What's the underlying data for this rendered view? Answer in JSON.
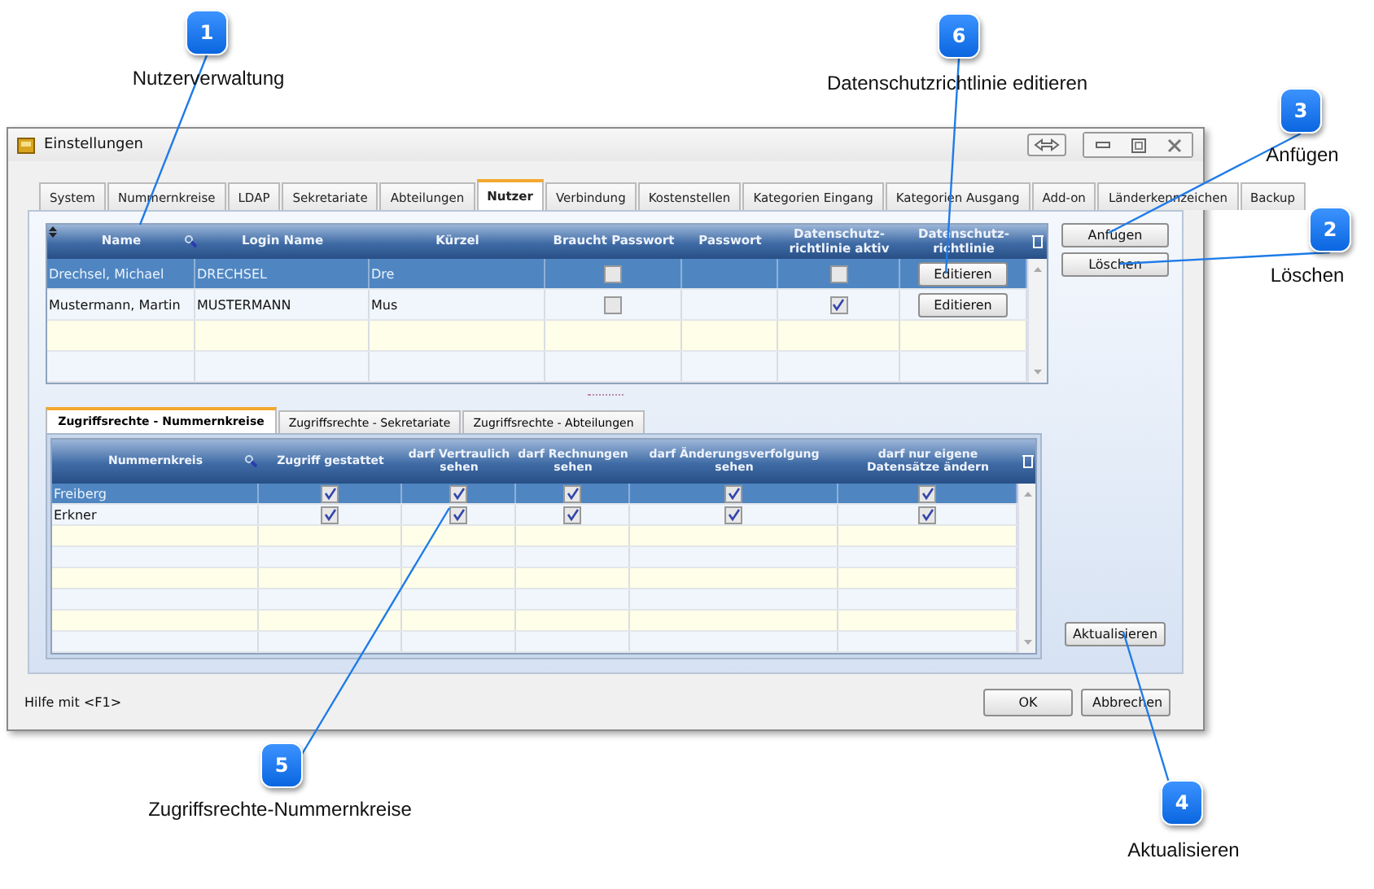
{
  "window": {
    "title": "Einstellungen"
  },
  "tabs": [
    {
      "label": "System",
      "selected": false
    },
    {
      "label": "Nummernkreise",
      "selected": false
    },
    {
      "label": "LDAP",
      "selected": false
    },
    {
      "label": "Sekretariate",
      "selected": false
    },
    {
      "label": "Abteilungen",
      "selected": false
    },
    {
      "label": "Nutzer",
      "selected": true
    },
    {
      "label": "Verbindung",
      "selected": false
    },
    {
      "label": "Kostenstellen",
      "selected": false
    },
    {
      "label": "Kategorien Eingang",
      "selected": false
    },
    {
      "label": "Kategorien Ausgang",
      "selected": false
    },
    {
      "label": "Add-on",
      "selected": false
    },
    {
      "label": "Länderkennzeichen",
      "selected": false
    },
    {
      "label": "Backup",
      "selected": false
    }
  ],
  "users_table": {
    "columns": [
      "Name",
      "Login Name",
      "Kürzel",
      "Braucht Passwort",
      "Passwort",
      "Datenschutz-richtlinie aktiv",
      "Datenschutz-richtlinie"
    ],
    "rows": [
      {
        "selected": true,
        "name": "Drechsel, Michael",
        "login": "DRECHSEL",
        "short": "Dre",
        "needs_password": false,
        "privacy_active": false,
        "button": "Editieren"
      },
      {
        "selected": false,
        "name": "Mustermann, Martin",
        "login": "MUSTERMANN",
        "short": "Mus",
        "needs_password": false,
        "privacy_active": true,
        "button": "Editieren"
      }
    ]
  },
  "side_buttons": [
    "Anfügen",
    "Löschen"
  ],
  "rights_tabs": [
    {
      "label": "Zugriffsrechte - Nummernkreise",
      "selected": true
    },
    {
      "label": "Zugriffsrechte - Sekretariate",
      "selected": false
    },
    {
      "label": "Zugriffsrechte - Abteilungen",
      "selected": false
    }
  ],
  "rights_table": {
    "columns": [
      "Nummernkreis",
      "Zugriff gestattet",
      "darf Vertraulich sehen",
      "darf Rechnungen sehen",
      "darf Änderungsverfolgung sehen",
      "darf nur eigene Datensätze ändern"
    ],
    "rows": [
      {
        "selected": true,
        "name": "Freiberg",
        "checks": [
          true,
          true,
          true,
          true,
          true
        ]
      },
      {
        "selected": false,
        "name": "Erkner",
        "checks": [
          true,
          true,
          true,
          true,
          true
        ]
      }
    ]
  },
  "refresh_button": "Aktualisieren",
  "status": "Hilfe mit <F1>",
  "dialog_buttons": [
    "OK",
    "Abbrechen"
  ],
  "callouts": [
    {
      "number": "1",
      "label": "Nutzerverwaltung"
    },
    {
      "number": "6",
      "label": "Datenschutzrichtlinie editieren"
    },
    {
      "number": "3",
      "label": "Anfügen"
    },
    {
      "number": "2",
      "label": "Löschen"
    },
    {
      "number": "5",
      "label": "Zugriffsrechte-Nummernkreise"
    },
    {
      "number": "4",
      "label": "Aktualisieren"
    }
  ]
}
